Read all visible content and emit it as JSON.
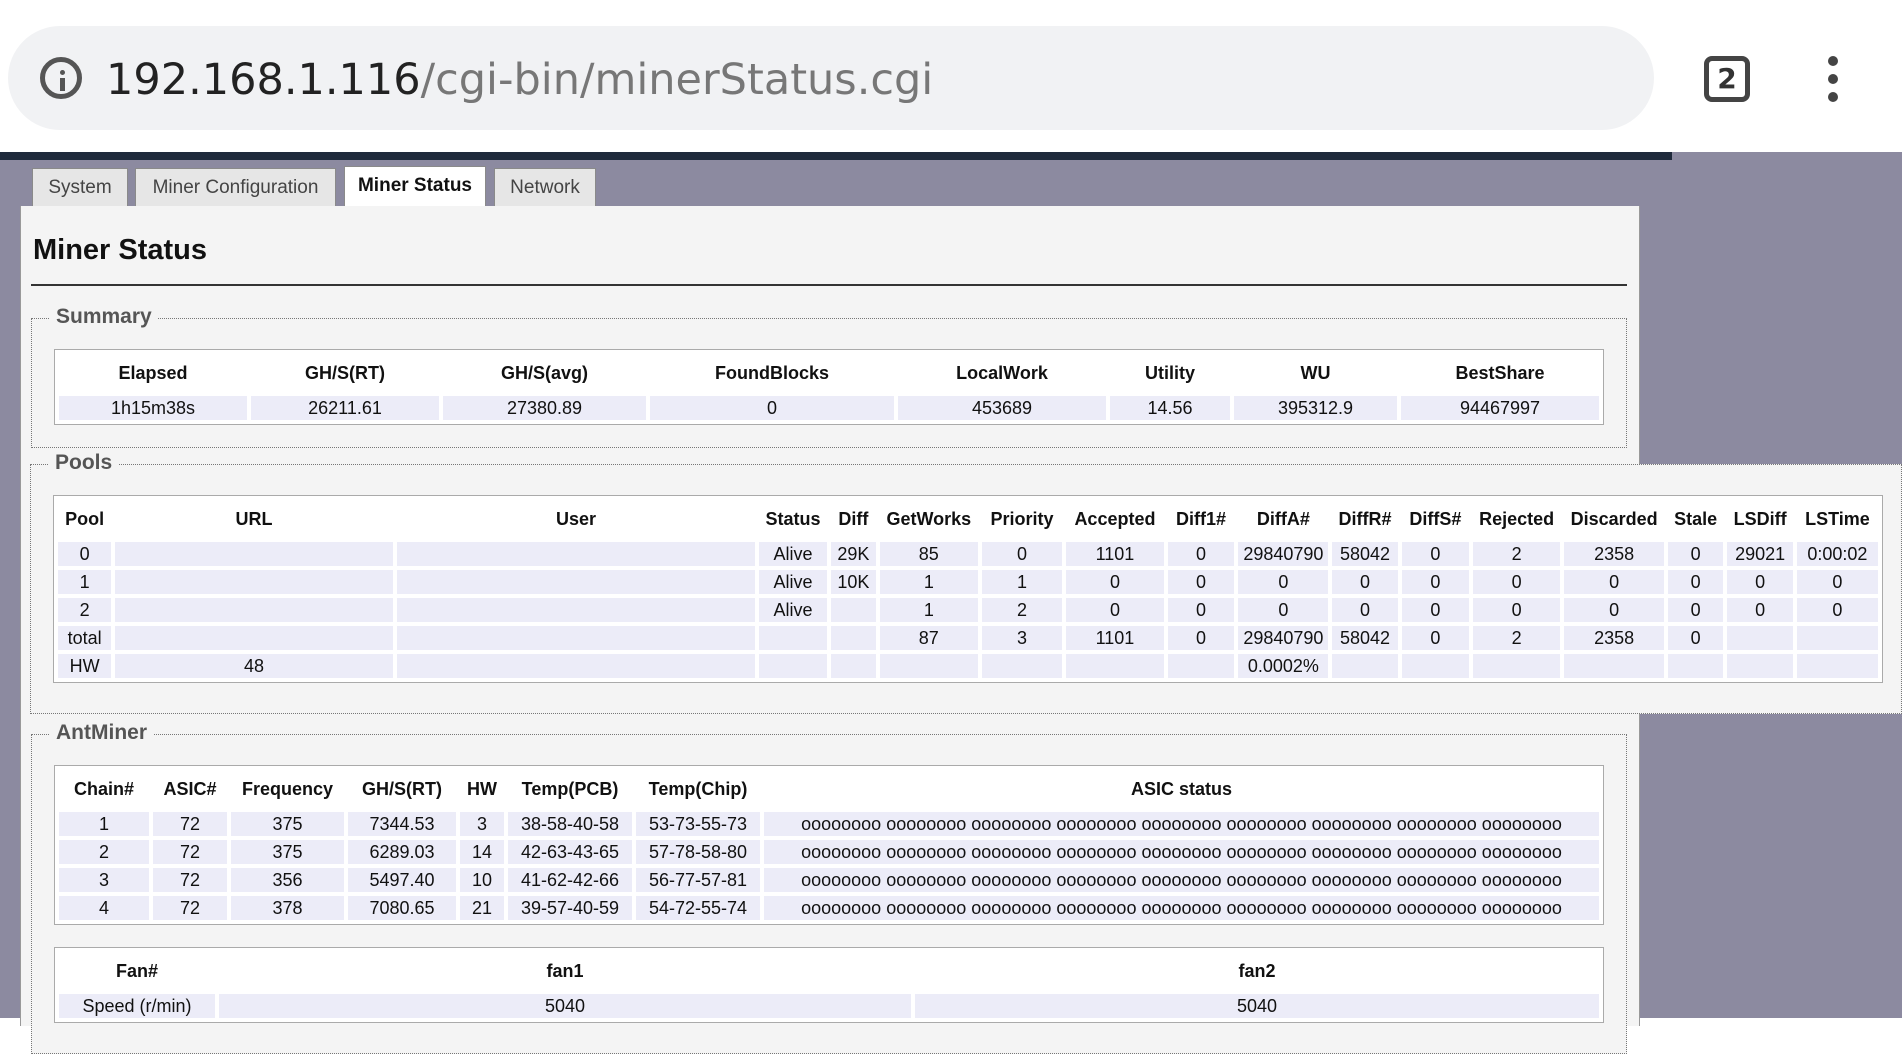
{
  "browser": {
    "url_host": "192.168.1.116",
    "url_path": "/cgi-bin/minerStatus.cgi",
    "tab_count": "2"
  },
  "nav_tabs": [
    "System",
    "Miner Configuration",
    "Miner Status",
    "Network"
  ],
  "page_title": "Miner Status",
  "summary": {
    "legend": "Summary",
    "headers": [
      "Elapsed",
      "GH/S(RT)",
      "GH/S(avg)",
      "FoundBlocks",
      "LocalWork",
      "Utility",
      "WU",
      "BestShare"
    ],
    "values": [
      "1h15m38s",
      "26211.61",
      "27380.89",
      "0",
      "453689",
      "14.56",
      "395312.9",
      "94467997"
    ]
  },
  "pools": {
    "legend": "Pools",
    "headers": [
      "Pool",
      "URL",
      "User",
      "Status",
      "Diff",
      "GetWorks",
      "Priority",
      "Accepted",
      "Diff1#",
      "DiffA#",
      "DiffR#",
      "DiffS#",
      "Rejected",
      "Discarded",
      "Stale",
      "LSDiff",
      "LSTime"
    ],
    "rows": [
      [
        "0",
        "",
        "",
        "Alive",
        "29K",
        "85",
        "0",
        "1101",
        "0",
        "29840790",
        "58042",
        "0",
        "2",
        "2358",
        "0",
        "29021",
        "0:00:02"
      ],
      [
        "1",
        "",
        "",
        "Alive",
        "10K",
        "1",
        "1",
        "0",
        "0",
        "0",
        "0",
        "0",
        "0",
        "0",
        "0",
        "0",
        "0"
      ],
      [
        "2",
        "",
        "",
        "Alive",
        "",
        "1",
        "2",
        "0",
        "0",
        "0",
        "0",
        "0",
        "0",
        "0",
        "0",
        "0",
        "0"
      ],
      [
        "total",
        "",
        "",
        "",
        "",
        "87",
        "3",
        "1101",
        "0",
        "29840790",
        "58042",
        "0",
        "2",
        "2358",
        "0",
        "",
        ""
      ],
      [
        "HW",
        "48",
        "",
        "",
        "",
        "",
        "",
        "",
        "",
        "0.0002%",
        "",
        "",
        "",
        "",
        "",
        "",
        ""
      ]
    ]
  },
  "antminer": {
    "legend": "AntMiner",
    "headers": [
      "Chain#",
      "ASIC#",
      "Frequency",
      "GH/S(RT)",
      "HW",
      "Temp(PCB)",
      "Temp(Chip)",
      "ASIC status"
    ],
    "rows": [
      [
        "1",
        "72",
        "375",
        "7344.53",
        "3",
        "38-58-40-58",
        "53-73-55-73",
        "oooooooo oooooooo oooooooo oooooooo oooooooo oooooooo oooooooo oooooooo oooooooo"
      ],
      [
        "2",
        "72",
        "375",
        "6289.03",
        "14",
        "42-63-43-65",
        "57-78-58-80",
        "oooooooo oooooooo oooooooo oooooooo oooooooo oooooooo oooooooo oooooooo oooooooo"
      ],
      [
        "3",
        "72",
        "356",
        "5497.40",
        "10",
        "41-62-42-66",
        "56-77-57-81",
        "oooooooo oooooooo oooooooo oooooooo oooooooo oooooooo oooooooo oooooooo oooooooo"
      ],
      [
        "4",
        "72",
        "378",
        "7080.65",
        "21",
        "39-57-40-59",
        "54-72-55-74",
        "oooooooo oooooooo oooooooo oooooooo oooooooo oooooooo oooooooo oooooooo oooooooo"
      ]
    ]
  },
  "fans": {
    "headers": [
      "Fan#",
      "fan1",
      "fan2"
    ],
    "row": [
      "Speed (r/min)",
      "5040",
      "5040"
    ]
  }
}
